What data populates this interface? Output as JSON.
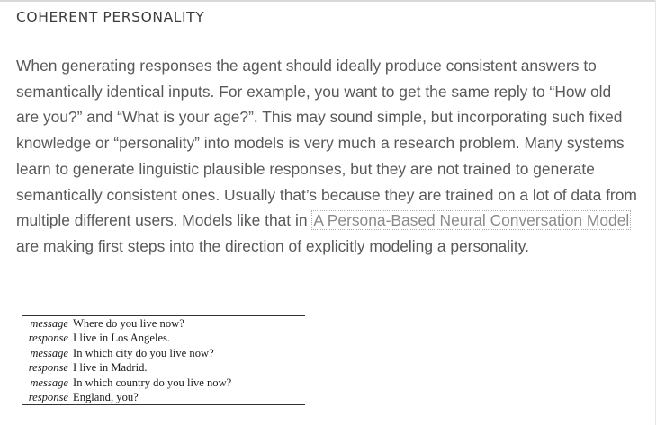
{
  "section": {
    "title": "COHERENT PERSONALITY"
  },
  "paragraph": {
    "before_link": "When generating responses the agent should ideally produce consistent answers to semantically identical inputs. For example, you want to get the same reply to “How old are you?” and “What is your age?”. This may sound simple, but incorporating such fixed knowledge or “personality” into models is very much a research problem. Many systems learn to generate linguistic plausible responses, but they are not trained to generate semantically consistent ones. Usually that’s because they are trained on a lot of data from multiple different users. Models like that in ",
    "link_text": "A Persona-Based Neural Conversation Model",
    "after_link": " are making first steps into the direction of explicitly modeling a personality."
  },
  "dialog": [
    {
      "speaker": "message",
      "text": "Where do you live now?"
    },
    {
      "speaker": "response",
      "text": "I live in Los Angeles."
    },
    {
      "speaker": "message",
      "text": "In which city do you live now?"
    },
    {
      "speaker": "response",
      "text": "I live in Madrid."
    },
    {
      "speaker": "message",
      "text": "In which country do you live now?"
    },
    {
      "speaker": "response",
      "text": "England, you?"
    }
  ],
  "colors": {
    "heading": "#3c3c3c",
    "body_text": "#595959",
    "link_text": "#8a8a8a",
    "link_border": "#a9a9a9",
    "table_rule": "#333333"
  }
}
